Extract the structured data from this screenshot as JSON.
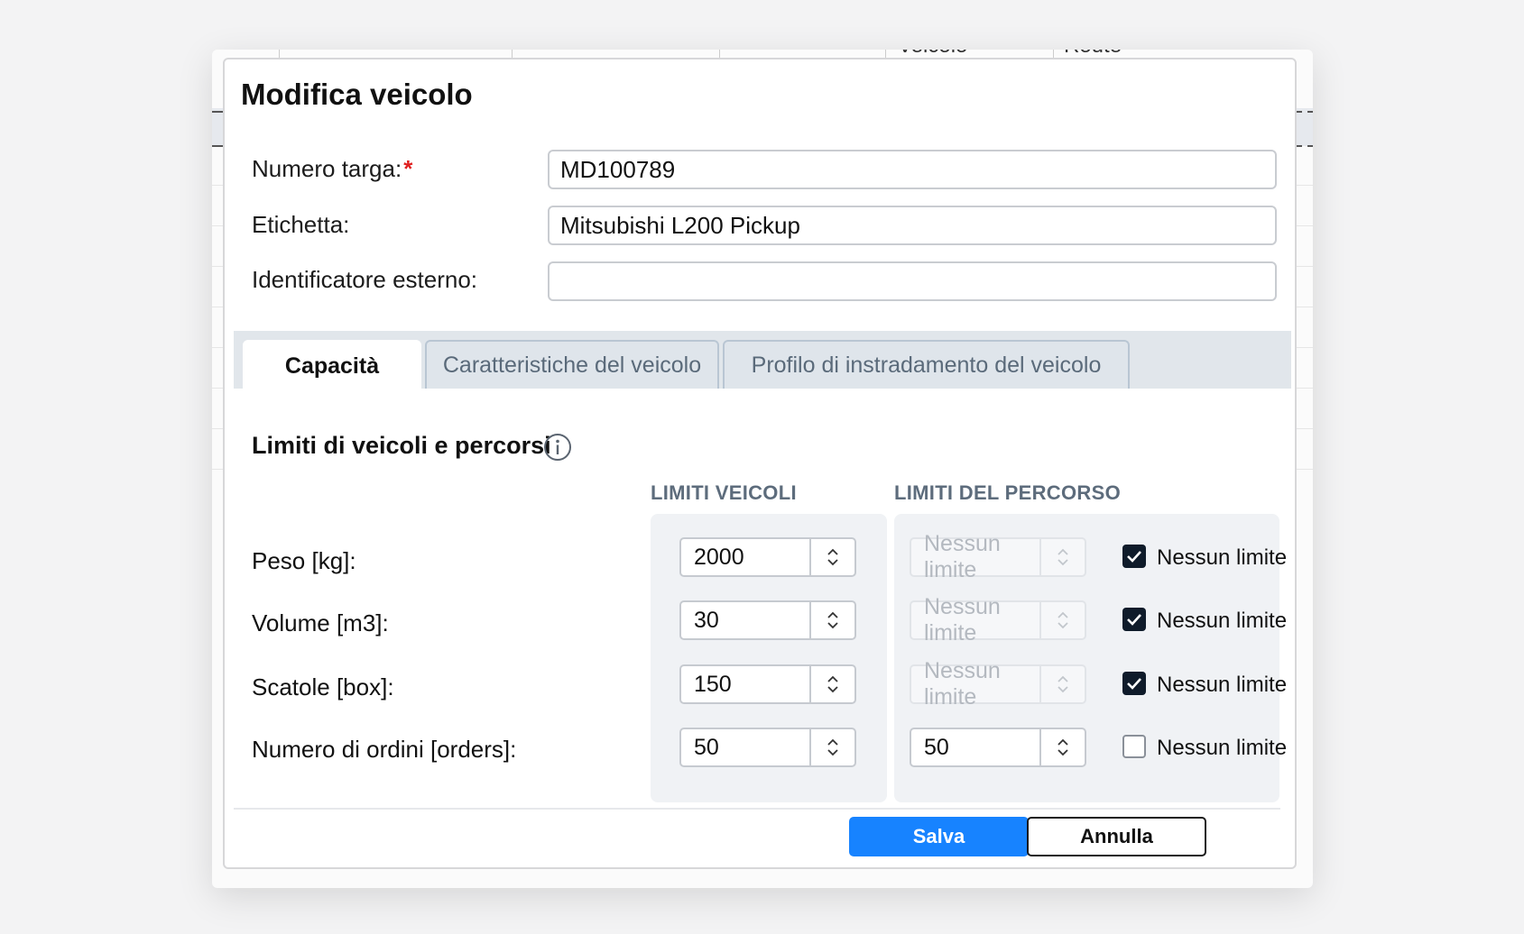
{
  "background": {
    "column_labels": [
      "Veicolo",
      "Route"
    ]
  },
  "dialog": {
    "title": "Modifica veicolo",
    "fields": {
      "plate": {
        "label": "Numero targa:",
        "required_mark": "*",
        "value": "MD100789"
      },
      "label": {
        "label": "Etichetta:",
        "value": "Mitsubishi L200 Pickup"
      },
      "external_id": {
        "label": "Identificatore esterno:",
        "value": ""
      }
    },
    "tabs": [
      {
        "label": "Capacità",
        "active": true
      },
      {
        "label": "Caratteristiche del veicolo",
        "active": false
      },
      {
        "label": "Profilo di instradamento del veicolo",
        "active": false
      }
    ],
    "section_title": "Limiti di veicoli e percorsi",
    "col_vehicle": "LIMITI VEICOLI",
    "col_route": "LIMITI DEL PERCORSO",
    "rows": [
      {
        "label": "Peso [kg]:",
        "vehicle_limit": "2000",
        "route_limit": "Nessun limite",
        "route_disabled": true,
        "no_limit_checked": true,
        "no_limit_label": "Nessun limite"
      },
      {
        "label": "Volume [m3]:",
        "vehicle_limit": "30",
        "route_limit": "Nessun limite",
        "route_disabled": true,
        "no_limit_checked": true,
        "no_limit_label": "Nessun limite"
      },
      {
        "label": "Scatole [box]:",
        "vehicle_limit": "150",
        "route_limit": "Nessun limite",
        "route_disabled": true,
        "no_limit_checked": true,
        "no_limit_label": "Nessun limite"
      },
      {
        "label": "Numero di ordini [orders]:",
        "vehicle_limit": "50",
        "route_limit": "50",
        "route_disabled": false,
        "no_limit_checked": false,
        "no_limit_label": "Nessun limite"
      }
    ],
    "buttons": {
      "save": "Salva",
      "cancel": "Annulla"
    },
    "colors": {
      "primary": "#1783ff",
      "checkbox_on": "#0f1b2a",
      "required": "#e02020"
    }
  }
}
